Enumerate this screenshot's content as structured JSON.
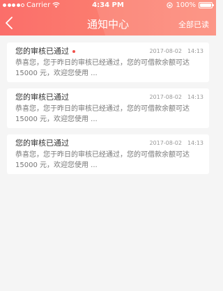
{
  "status_bar": {
    "carrier": "Carrier",
    "time": "4:34 PM",
    "battery": "100%"
  },
  "nav": {
    "title": "通知中心",
    "mark_all_read": "全部已读"
  },
  "colors": {
    "header_start": "#fb6e6a",
    "header_end": "#fc8b7a",
    "unread_dot": "#f0504a"
  },
  "notifications": [
    {
      "title": "您的审核已通过",
      "unread": true,
      "date": "2017-08-02",
      "time": "14:13",
      "line1": "恭喜您，您于昨日的审核已经通过，您的可借款余额可达",
      "line2": "15000 元，欢迎您使用 ..."
    },
    {
      "title": "您的审核已通过",
      "unread": false,
      "date": "2017-08-02",
      "time": "14:13",
      "line1": "恭喜您，您于昨日的审核已经通过，您的可借款余额可达",
      "line2": "15000 元，欢迎您使用 ..."
    },
    {
      "title": "您的审核已通过",
      "unread": false,
      "date": "2017-08-02",
      "time": "14:13",
      "line1": "恭喜您，您于昨日的审核已经通过，您的可借款余额可达",
      "line2": "15000 元，欢迎您使用 ..."
    }
  ]
}
